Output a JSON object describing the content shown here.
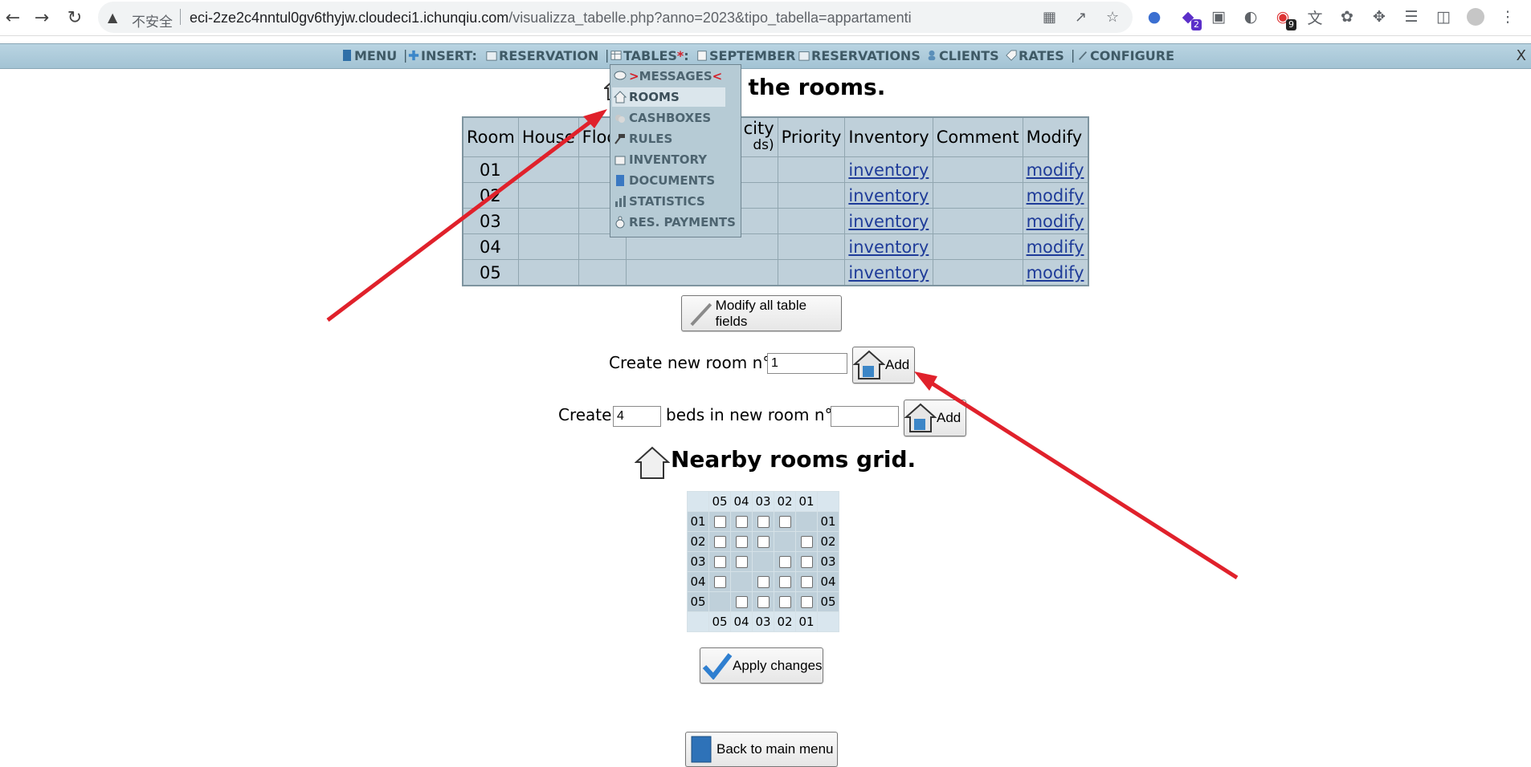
{
  "browser": {
    "insecure_label": "不安全",
    "url_host": "eci-2ze2c4nntul0gv6thyjw.cloudeci1.ichunqiu.com",
    "url_path": "/visualizza_tabelle.php?anno=2023&tipo_tabella=appartamenti",
    "ext_badge_1": "2",
    "ext_badge_2": "9"
  },
  "menubar": {
    "menu": "MENU",
    "sep": "|",
    "insert": "INSERT:",
    "reservation": "RESERVATION",
    "tables": "TABLES",
    "tables_star": "*",
    "tables_colon": ":",
    "september": "SEPTEMBER",
    "reservations": "RESERVATIONS",
    "clients": "CLIENTS",
    "rates": "RATES",
    "configure": "CONFIGURE",
    "close": "X"
  },
  "dropdown": {
    "items": [
      {
        "label": "MESSAGES",
        "prefix": ">",
        "suffix": "<"
      },
      {
        "label": "ROOMS"
      },
      {
        "label": "CASHBOXES"
      },
      {
        "label": "RULES"
      },
      {
        "label": "INVENTORY"
      },
      {
        "label": "DOCUMENTS"
      },
      {
        "label": "STATISTICS"
      },
      {
        "label": "RES. PAYMENTS"
      }
    ]
  },
  "main": {
    "heading_tail": "h all the rooms.",
    "table": {
      "headers": [
        "Room",
        "House",
        "Floo",
        "city",
        "ds)",
        "Priority",
        "Inventory",
        "Comment",
        "Modify"
      ],
      "rows": [
        {
          "room": "01",
          "inventory": "inventory",
          "modify": "modify"
        },
        {
          "room": "02",
          "inventory": "inventory",
          "modify": "modify"
        },
        {
          "room": "03",
          "inventory": "inventory",
          "modify": "modify"
        },
        {
          "room": "04",
          "inventory": "inventory",
          "modify": "modify"
        },
        {
          "room": "05",
          "inventory": "inventory",
          "modify": "modify"
        }
      ]
    },
    "modify_all_label": "Modify all table fields",
    "create_room_label": "Create new room n°",
    "create_room_value": "1",
    "add_label": "Add",
    "create_beds_prefix": "Create",
    "create_beds_value": "4",
    "create_beds_middle": "beds in new room n°",
    "create_beds_room_value": "",
    "grid_heading": "Nearby rooms grid.",
    "grid": {
      "cols": [
        "05",
        "04",
        "03",
        "02",
        "01"
      ],
      "rows": [
        "01",
        "02",
        "03",
        "04",
        "05"
      ]
    },
    "apply_label": "Apply changes",
    "back_label": "Back to main menu"
  },
  "annotation_color": "#e0212b"
}
